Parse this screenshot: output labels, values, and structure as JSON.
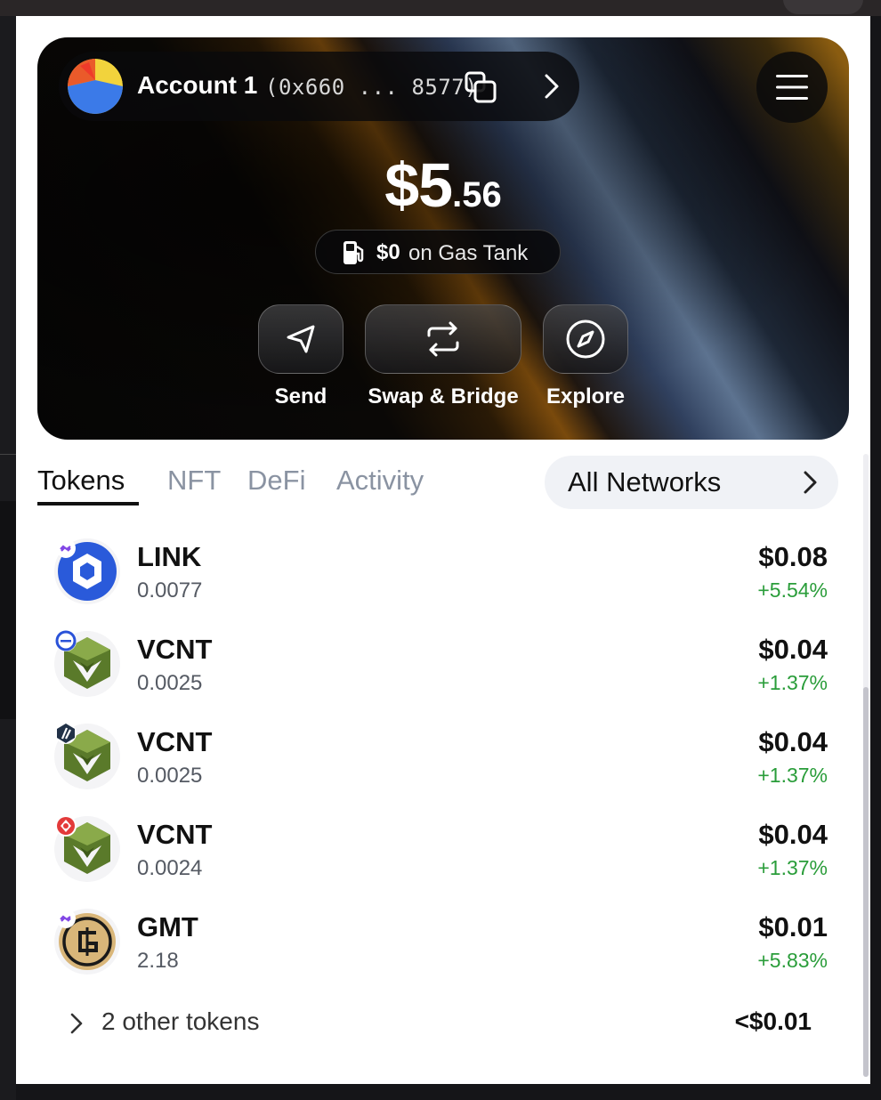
{
  "account": {
    "name": "Account 1",
    "address": "(0x660 ... 8577)"
  },
  "balance": {
    "whole": "$5",
    "cents": ".56"
  },
  "gas_tank": {
    "amount": "$0",
    "label": "on Gas Tank"
  },
  "actions": [
    {
      "label": "Send",
      "icon": "send-icon"
    },
    {
      "label": "Swap & Bridge",
      "icon": "swap-icon"
    },
    {
      "label": "Explore",
      "icon": "compass-icon"
    }
  ],
  "tabs": [
    {
      "label": "Tokens",
      "active": true
    },
    {
      "label": "NFT",
      "active": false
    },
    {
      "label": "DeFi",
      "active": false
    },
    {
      "label": "Activity",
      "active": false
    }
  ],
  "networks": {
    "label": "All Networks"
  },
  "tokens": [
    {
      "symbol": "LINK",
      "amount": "0.0077",
      "usd": "$0.08",
      "change": "+5.54%",
      "icon": "chainlink-icon",
      "network_icon": "polygon-icon"
    },
    {
      "symbol": "VCNT",
      "amount": "0.0025",
      "usd": "$0.04",
      "change": "+1.37%",
      "icon": "vcnt-icon",
      "network_icon": "base-icon"
    },
    {
      "symbol": "VCNT",
      "amount": "0.0025",
      "usd": "$0.04",
      "change": "+1.37%",
      "icon": "vcnt-icon",
      "network_icon": "arbitrum-icon"
    },
    {
      "symbol": "VCNT",
      "amount": "0.0024",
      "usd": "$0.04",
      "change": "+1.37%",
      "icon": "vcnt-icon",
      "network_icon": "optimism-icon"
    },
    {
      "symbol": "GMT",
      "amount": "2.18",
      "usd": "$0.01",
      "change": "+5.83%",
      "icon": "gmt-icon",
      "network_icon": "polygon-icon"
    }
  ],
  "other_tokens": {
    "label": "2 other tokens",
    "value": "<$0.01"
  },
  "colors": {
    "positive": "#2a9d3a",
    "muted": "#8a93a2",
    "link_blue": "#2a5ada",
    "vcnt_green": "#5a7a2a"
  }
}
